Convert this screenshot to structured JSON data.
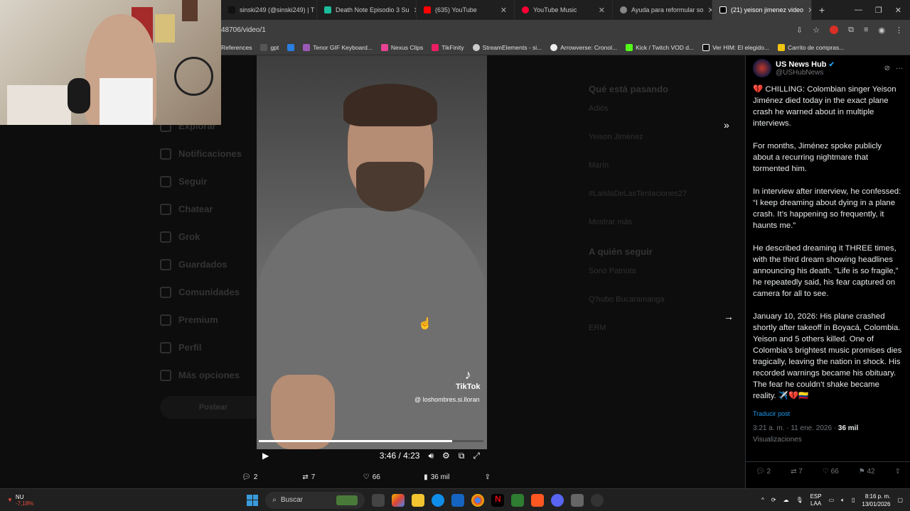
{
  "browser": {
    "tabs": [
      {
        "label": "sinski249 (@sinski249) | T",
        "color": "#111111",
        "active": false
      },
      {
        "label": "Death Note Episodio 3 Su",
        "color": "#1abc9c",
        "active": false
      },
      {
        "label": "(635) YouTube",
        "color": "#ff0000",
        "active": false
      },
      {
        "label": "YouTube Music",
        "color": "#ff0033",
        "active": false
      },
      {
        "label": "Ayuda para reformular so",
        "color": "#888888",
        "active": false
      },
      {
        "label": "(21) yeison jimenez video",
        "color": "#000000",
        "active": true
      }
    ],
    "url": "48706/video/1",
    "bookmarks": [
      "References",
      "gpt",
      "L",
      "Tenor GIF Keyboard...",
      "Nexus Clips",
      "TikFinity",
      "StreamElements - si...",
      "Arrowverse: Cronol...",
      "Kick / Twitch VOD d...",
      "Ver HIM: El elegido...",
      "Carrito de compras..."
    ]
  },
  "background_nav": [
    "Explorar",
    "Notificaciones",
    "Seguir",
    "Chatear",
    "Grok",
    "Guardados",
    "Comunidades",
    "Premium",
    "Perfil",
    "Más opciones"
  ],
  "background_nav_button": "Postear",
  "background_right": {
    "title": "Qué está pasando",
    "items": [
      "Adiós",
      "Yeison Jiménez",
      "Marín",
      "#LaIslaDeLasTentaciones27",
      "Mostrar más"
    ],
    "follow_title": "A quién seguir",
    "follow_items": [
      "Sonó Patriota",
      "Q'hubo Bucaramanga",
      "ERM"
    ]
  },
  "video": {
    "watermark_brand": "TikTok",
    "watermark_handle": "@ loshombres.si.lloran",
    "time": "3:46 / 4:23",
    "progress": 0.86
  },
  "actions": {
    "replies": "2",
    "reposts": "7",
    "likes": "66",
    "views": "36 mil"
  },
  "tweet": {
    "name": "US News Hub",
    "handle": "@USHubNews",
    "paragraphs": [
      "💔 CHILLING: Colombian singer Yeison Jiménez died today in the exact plane crash he warned about in multiple interviews.",
      "For months, Jiménez spoke publicly about a recurring nightmare that tormented him.",
      "In interview after interview, he confessed: “I keep dreaming about dying in a plane crash. It’s happening so frequently, it haunts me.”",
      "He described dreaming it THREE times, with the third dream showing headlines announcing his death. “Life is so fragile,” he repeatedly said, his fear captured on camera for all to see.",
      "January 10, 2026: His plane crashed shortly after takeoff in Boyacá, Colombia. Yeison and 5 others killed. One of Colombia’s brightest music promises dies tragically, leaving the nation in shock. His recorded warnings became his obituary. The fear he couldn’t shake became reality. ✈️💔🇨🇴"
    ],
    "translate": "Traducir post",
    "timestamp": "3:21 a. m. · 11 ene. 2026 ·",
    "views_count": "36 mil",
    "views_label": "Visualizaciones",
    "stats": {
      "replies": "2",
      "reposts": "7",
      "likes": "66",
      "bookmarks": "42"
    }
  },
  "taskbar": {
    "weather_label": "NU",
    "weather_value": "-7,18%",
    "search_placeholder": "Buscar",
    "lang": "ESP",
    "lang_sub": "LAA",
    "time": "8:16 p. m.",
    "date": "13/01/2026"
  }
}
